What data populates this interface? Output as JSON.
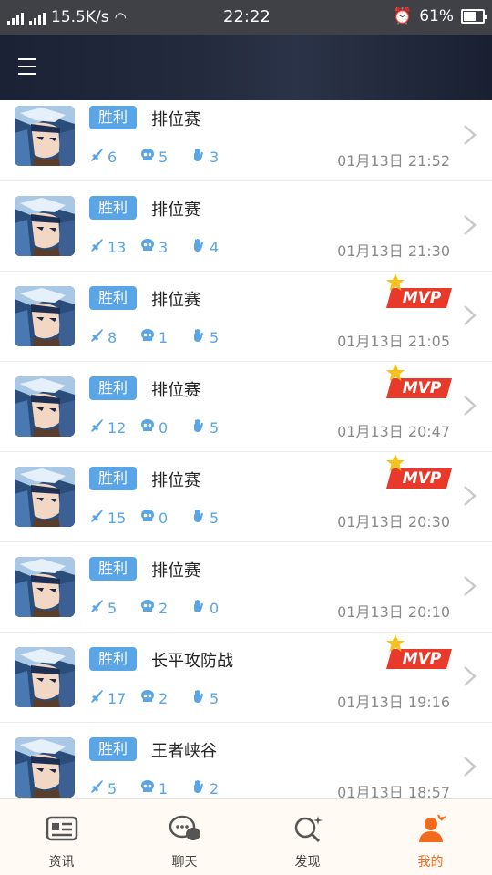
{
  "status_bar": {
    "network_speed": "15.5K/s",
    "time": "22:22",
    "battery": "61%",
    "battery_level": 0.61
  },
  "header": {
    "menu_icon": "hamburger-menu-icon"
  },
  "matches": [
    {
      "result": "胜利",
      "mode": "排位赛",
      "kills": "6",
      "deaths": "5",
      "assists": "3",
      "time": "01月13日 21:52",
      "mvp": false
    },
    {
      "result": "胜利",
      "mode": "排位赛",
      "kills": "13",
      "deaths": "3",
      "assists": "4",
      "time": "01月13日 21:30",
      "mvp": false
    },
    {
      "result": "胜利",
      "mode": "排位赛",
      "kills": "8",
      "deaths": "1",
      "assists": "5",
      "time": "01月13日 21:05",
      "mvp": true
    },
    {
      "result": "胜利",
      "mode": "排位赛",
      "kills": "12",
      "deaths": "0",
      "assists": "5",
      "time": "01月13日 20:47",
      "mvp": true
    },
    {
      "result": "胜利",
      "mode": "排位赛",
      "kills": "15",
      "deaths": "0",
      "assists": "5",
      "time": "01月13日 20:30",
      "mvp": true
    },
    {
      "result": "胜利",
      "mode": "排位赛",
      "kills": "5",
      "deaths": "2",
      "assists": "0",
      "time": "01月13日 20:10",
      "mvp": false
    },
    {
      "result": "胜利",
      "mode": "长平攻防战",
      "kills": "17",
      "deaths": "2",
      "assists": "5",
      "time": "01月13日 19:16",
      "mvp": true
    },
    {
      "result": "胜利",
      "mode": "王者峡谷",
      "kills": "5",
      "deaths": "1",
      "assists": "2",
      "time": "01月13日 18:57",
      "mvp": false
    }
  ],
  "mvp_label": "MVP",
  "tabs": [
    {
      "label": "资讯",
      "icon": "news-icon",
      "active": false
    },
    {
      "label": "聊天",
      "icon": "chat-icon",
      "active": false
    },
    {
      "label": "发现",
      "icon": "discover-icon",
      "active": false
    },
    {
      "label": "我的",
      "icon": "profile-icon",
      "active": true
    }
  ],
  "colors": {
    "accent": "#5aa5e6",
    "active_tab": "#f26a1b",
    "mvp_red": "#e8392b",
    "mvp_star": "#f7c11d"
  }
}
